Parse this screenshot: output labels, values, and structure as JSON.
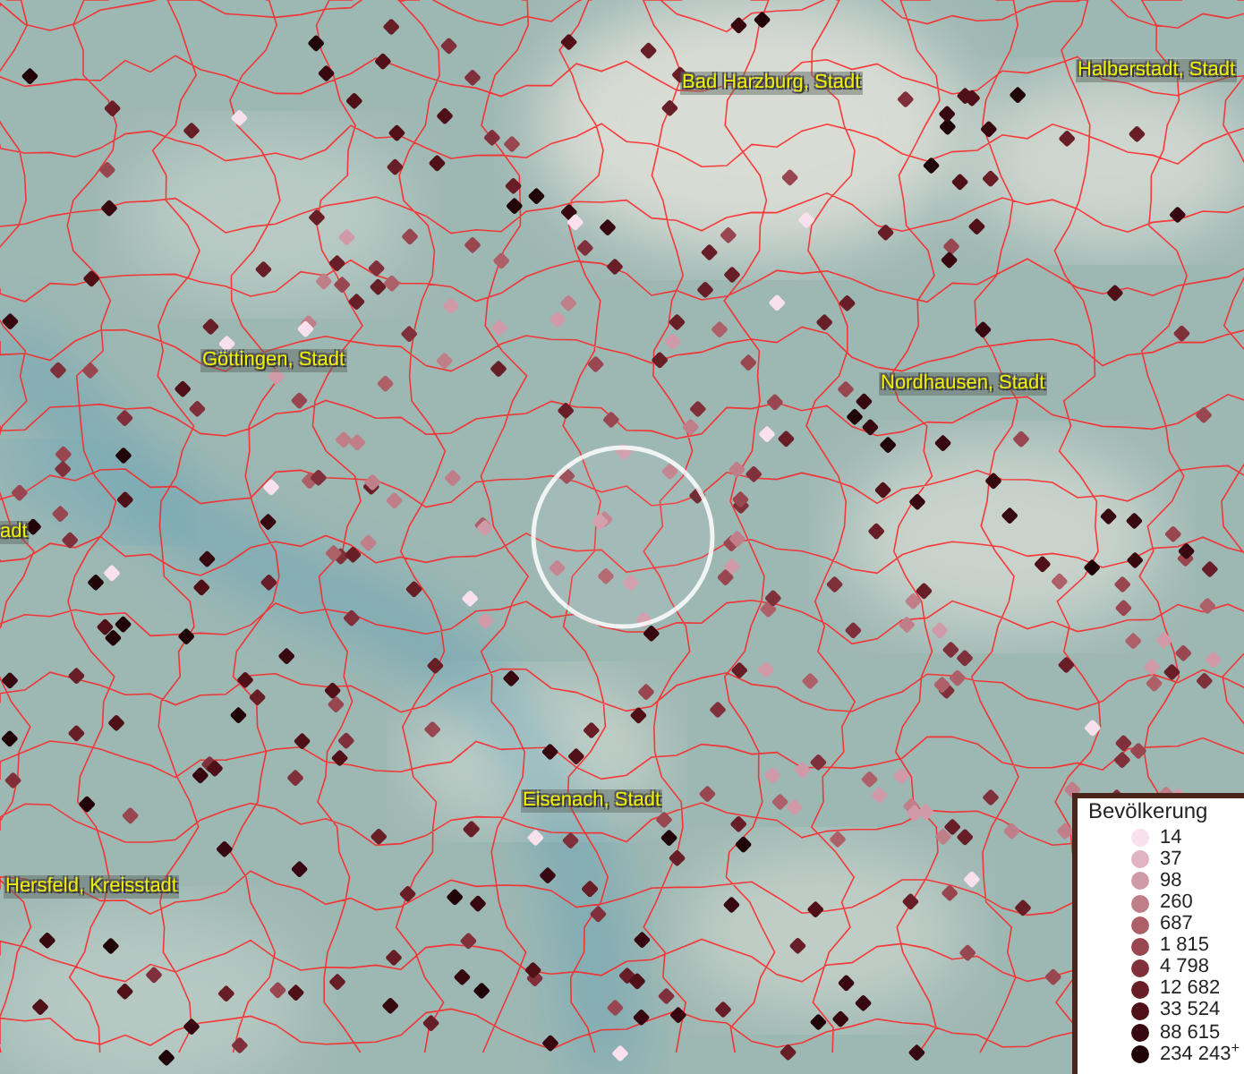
{
  "map": {
    "place_labels": [
      {
        "text": "Bad Harzburg, Stadt"
      },
      {
        "text": "Halberstadt, Stadt"
      },
      {
        "text": "Göttingen, Stadt"
      },
      {
        "text": "Nordhausen, Stadt"
      },
      {
        "text": "adt"
      },
      {
        "text": "Eisenach, Stadt"
      },
      {
        "text": "Hersfeld, Kreisstadt"
      }
    ]
  },
  "legend": {
    "title": "Bevölkerung",
    "items": [
      {
        "label": "14",
        "color": "#f8e0ec"
      },
      {
        "label": "37",
        "color": "#e0b4c2"
      },
      {
        "label": "98",
        "color": "#d09aa8"
      },
      {
        "label": "260",
        "color": "#c07e88"
      },
      {
        "label": "687",
        "color": "#ae6068"
      },
      {
        "label": "1 815",
        "color": "#984650"
      },
      {
        "label": "4 798",
        "color": "#80303a"
      },
      {
        "label": "12 682",
        "color": "#681e26"
      },
      {
        "label": "33 524",
        "color": "#501018"
      },
      {
        "label": "88 615",
        "color": "#380810"
      },
      {
        "label": "234 243$^{+}$",
        "color": "#200408"
      }
    ]
  }
}
